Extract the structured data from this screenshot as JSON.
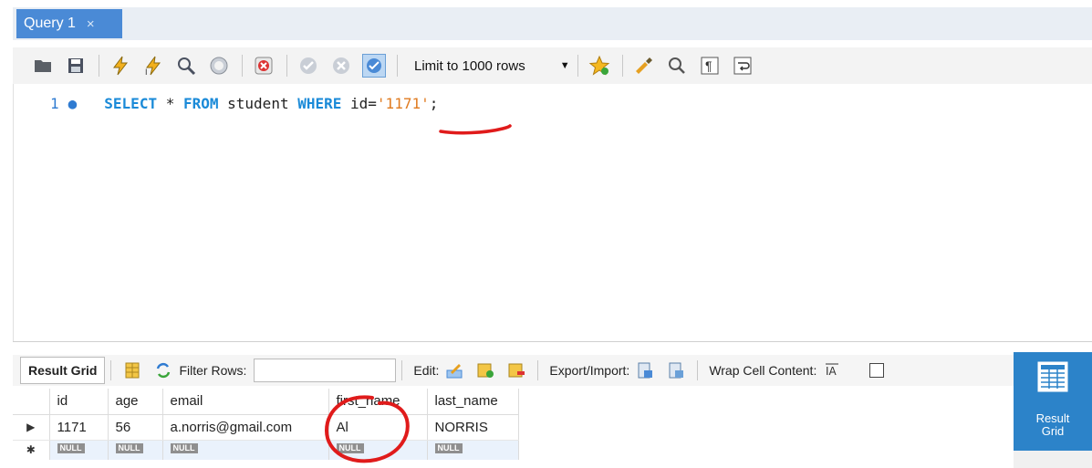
{
  "tab": {
    "title": "Query 1",
    "close": "×"
  },
  "toolbar": {
    "limit_label": "Limit to 1000 rows",
    "icons": [
      "folder-icon",
      "save-icon",
      "execute-icon",
      "execute-current-icon",
      "explain-icon",
      "stop-icon",
      "stop-on-error-icon",
      "commit-icon",
      "rollback-icon",
      "autocommit-icon",
      "bookmark-icon",
      "beautify-icon",
      "find-icon",
      "invisible-chars-icon",
      "wrap-icon"
    ]
  },
  "editor": {
    "line_number": "1",
    "marker": "●",
    "tokens": {
      "select": "SELECT",
      "star": " * ",
      "from": "FROM",
      "table": " student ",
      "where": "WHERE",
      "col": " id=",
      "value": "'1171'",
      "semi": ";"
    }
  },
  "results": {
    "tab_label": "Result Grid",
    "filter_label": "Filter Rows:",
    "edit_label": "Edit:",
    "export_label": "Export/Import:",
    "wrap_label": "Wrap Cell Content:",
    "columns": [
      "id",
      "age",
      "email",
      "first_name",
      "last_name"
    ],
    "row": [
      "1171",
      "56",
      "a.norris@gmail.com",
      "Al",
      "NORRIS"
    ],
    "null_label": "NULL",
    "row_pointer": "▶",
    "new_row_marker": "✱"
  },
  "side_panel": {
    "label_line1": "Result",
    "label_line2": "Grid"
  },
  "colors": {
    "accent": "#4a8ad6",
    "side_button": "#2c83c9",
    "keyword": "#1a8ad8",
    "string": "#e07b20",
    "annotation": "#e01b1b"
  }
}
